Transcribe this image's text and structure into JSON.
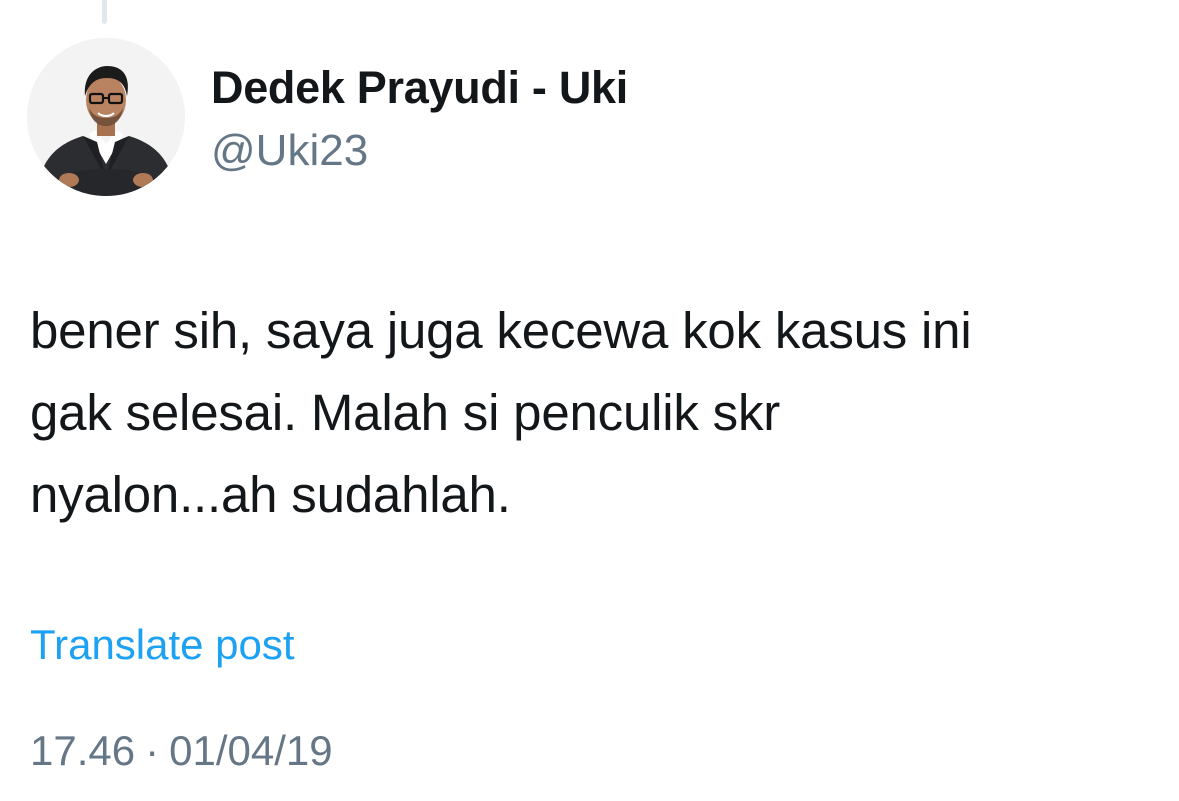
{
  "author": {
    "display_name": "Dedek Prayudi - Uki",
    "handle": "@Uki23",
    "avatar_icon": "profile-photo"
  },
  "tweet": {
    "lines": [
      "bener sih, saya juga kecewa kok kasus ini",
      "gak selesai. Malah si penculik skr",
      "nyalon...ah sudahlah."
    ],
    "translate_label": "Translate post",
    "time": "17.46",
    "separator": "·",
    "date": "01/04/19"
  },
  "colors": {
    "text": "#14171a",
    "secondary": "#657786",
    "link": "#1da1f2",
    "thread_line": "#e1e8ed"
  }
}
